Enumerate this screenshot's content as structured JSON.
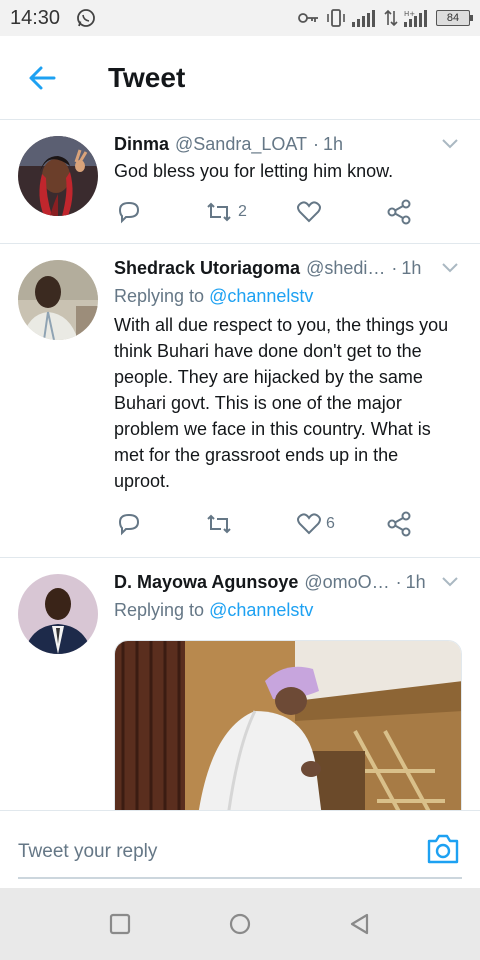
{
  "status_bar": {
    "time": "14:30",
    "battery": "84",
    "icons": [
      "whatsapp-icon",
      "key-icon",
      "vibrate-icon",
      "signal-icon",
      "data-4g-icon",
      "signal-icon-2",
      "battery-icon"
    ]
  },
  "header": {
    "title": "Tweet",
    "back_icon": "arrow-left-icon",
    "accent": "#1da1f2"
  },
  "tweets": [
    {
      "name": "Dinma",
      "handle": "@Sandra_LOAT",
      "sep": "·",
      "time": "1h",
      "reply_prefix": "",
      "reply_mention": "",
      "body": "God bless you for letting him know.",
      "retweets": "2",
      "likes": ""
    },
    {
      "name": "Shedrack Utoriagoma",
      "handle": "@shedi…",
      "sep": "·",
      "time": "1h",
      "reply_prefix": "Replying to ",
      "reply_mention": "@channelstv",
      "body": "With all due respect to you, the things you think Buhari have done don't get to the people. They are hijacked by the same Buhari govt. This is one of the major problem we face in this country. What is met for the grassroot ends up in the uproot.",
      "retweets": "",
      "likes": "6"
    },
    {
      "name": "D. Mayowa Agunsoye",
      "handle": "@omoO…",
      "sep": "·",
      "time": "1h",
      "reply_prefix": "Replying to ",
      "reply_mention": "@channelstv",
      "body": "",
      "media": "photo",
      "retweets": "",
      "likes": ""
    }
  ],
  "composer": {
    "placeholder": "Tweet your reply",
    "camera_icon": "camera-icon"
  },
  "nav": {
    "icons": [
      "recent-apps-icon",
      "home-icon",
      "back-triangle-icon"
    ]
  }
}
